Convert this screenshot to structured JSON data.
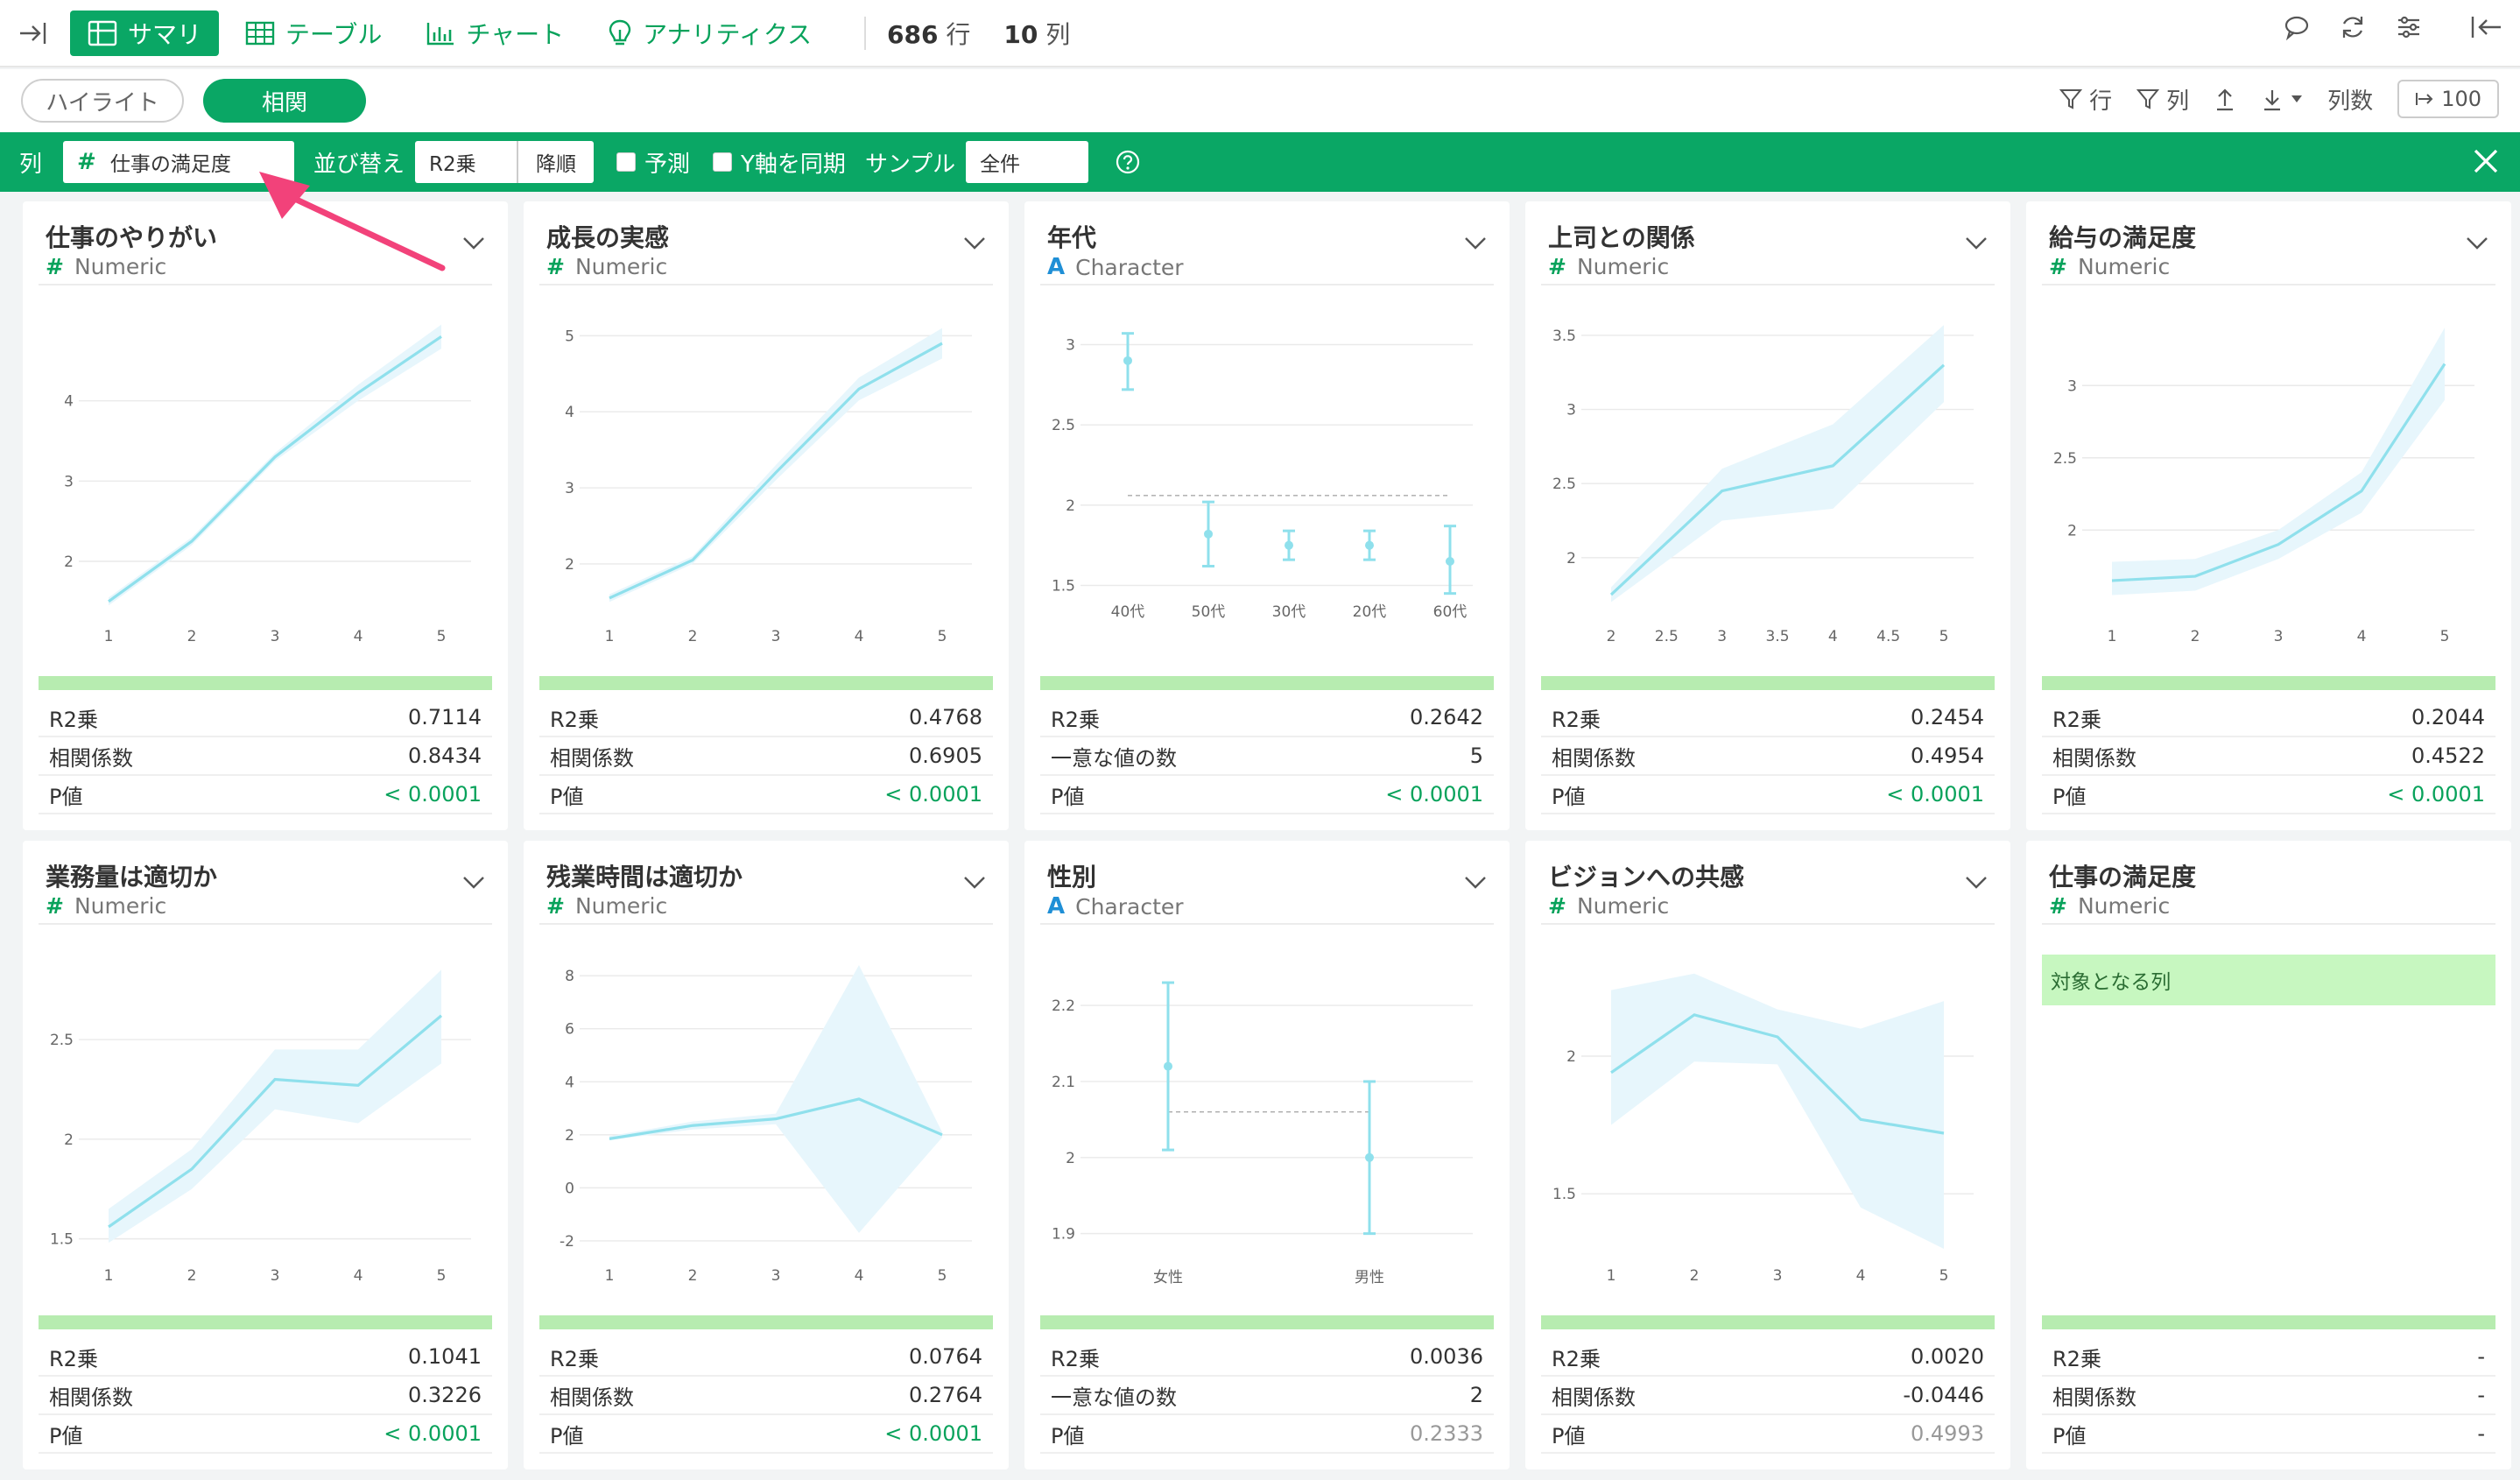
{
  "topbar": {
    "tabs": [
      {
        "label": "サマリ",
        "icon": "grid-icon",
        "active": true
      },
      {
        "label": "テーブル",
        "icon": "table-icon",
        "active": false
      },
      {
        "label": "チャート",
        "icon": "bar-chart-icon",
        "active": false
      },
      {
        "label": "アナリティクス",
        "icon": "lightbulb-icon",
        "active": false
      }
    ],
    "rows": "686",
    "rows_unit": "行",
    "cols": "10",
    "cols_unit": "列"
  },
  "secondbar": {
    "highlight_label": "ハイライト",
    "correlation_label": "相関",
    "filter_row_label": "行",
    "filter_col_label": "列",
    "columns_label": "列数",
    "columns_value": "100"
  },
  "greenbar": {
    "col_label": "列",
    "target_column": "仕事の満足度",
    "sort_label": "並び替え",
    "sort_field": "R2乗",
    "sort_order": "降順",
    "predict_label": "予測",
    "sync_y_label": "Y軸を同期",
    "sample_label": "サンプル",
    "sample_value": "全件"
  },
  "stat_labels": {
    "r2": "R2乗",
    "corr": "相関係数",
    "unique": "一意な値の数",
    "p": "P値"
  },
  "cards": [
    {
      "title": "仕事のやりがい",
      "type": "Numeric",
      "stat2_label": "相関係数",
      "r2": "0.7114",
      "stat2": "0.8434",
      "p": "< 0.0001",
      "p_sig": true
    },
    {
      "title": "成長の実感",
      "type": "Numeric",
      "stat2_label": "相関係数",
      "r2": "0.4768",
      "stat2": "0.6905",
      "p": "< 0.0001",
      "p_sig": true
    },
    {
      "title": "年代",
      "type": "Character",
      "stat2_label": "一意な値の数",
      "r2": "0.2642",
      "stat2": "5",
      "p": "< 0.0001",
      "p_sig": true
    },
    {
      "title": "上司との関係",
      "type": "Numeric",
      "stat2_label": "相関係数",
      "r2": "0.2454",
      "stat2": "0.4954",
      "p": "< 0.0001",
      "p_sig": true
    },
    {
      "title": "給与の満足度",
      "type": "Numeric",
      "stat2_label": "相関係数",
      "r2": "0.2044",
      "stat2": "0.4522",
      "p": "< 0.0001",
      "p_sig": true
    },
    {
      "title": "業務量は適切か",
      "type": "Numeric",
      "stat2_label": "相関係数",
      "r2": "0.1041",
      "stat2": "0.3226",
      "p": "< 0.0001",
      "p_sig": true
    },
    {
      "title": "残業時間は適切か",
      "type": "Numeric",
      "stat2_label": "相関係数",
      "r2": "0.0764",
      "stat2": "0.2764",
      "p": "< 0.0001",
      "p_sig": true
    },
    {
      "title": "性別",
      "type": "Character",
      "stat2_label": "一意な値の数",
      "r2": "0.0036",
      "stat2": "2",
      "p": "0.2333",
      "p_sig": false
    },
    {
      "title": "ビジョンへの共感",
      "type": "Numeric",
      "stat2_label": "相関係数",
      "r2": "0.0020",
      "stat2": "-0.0446",
      "p": "0.4993",
      "p_sig": false
    },
    {
      "title": "仕事の満足度",
      "type": "Numeric",
      "stat2_label": "相関係数",
      "r2": "-",
      "stat2": "-",
      "p": "-",
      "p_sig": false,
      "is_target": true,
      "target_text": "対象となる列"
    }
  ],
  "chart_data": [
    {
      "type": "line",
      "title": "仕事のやりがい",
      "x": [
        1,
        2,
        3,
        4,
        5
      ],
      "y": [
        1.5,
        2.25,
        3.3,
        4.1,
        4.8
      ],
      "ci_low": [
        1.45,
        2.2,
        3.25,
        4.0,
        4.65
      ],
      "ci_high": [
        1.55,
        2.3,
        3.35,
        4.2,
        4.95
      ],
      "xticks": [
        "1",
        "2",
        "3",
        "4",
        "5"
      ],
      "yticks": [
        2,
        3,
        4
      ],
      "ylim": [
        1.4,
        5.0
      ]
    },
    {
      "type": "line",
      "title": "成長の実感",
      "x": [
        1,
        2,
        3,
        4,
        5
      ],
      "y": [
        1.55,
        2.05,
        3.2,
        4.3,
        4.9
      ],
      "ci_low": [
        1.5,
        2.0,
        3.1,
        4.15,
        4.7
      ],
      "ci_high": [
        1.6,
        2.1,
        3.3,
        4.45,
        5.1
      ],
      "xticks": [
        "1",
        "2",
        "3",
        "4",
        "5"
      ],
      "yticks": [
        2,
        3,
        4,
        5
      ],
      "ylim": [
        1.4,
        5.2
      ]
    },
    {
      "type": "errorbar",
      "title": "年代",
      "categories": [
        "40代",
        "50代",
        "30代",
        "20代",
        "60代"
      ],
      "y": [
        2.9,
        1.82,
        1.75,
        1.75,
        1.65
      ],
      "err_low": [
        2.72,
        1.62,
        1.66,
        1.66,
        1.45
      ],
      "err_high": [
        3.07,
        2.02,
        1.84,
        1.84,
        1.87
      ],
      "mean_line": 2.06,
      "yticks": [
        1.5,
        2,
        2.5,
        3
      ],
      "ylim": [
        1.35,
        3.15
      ]
    },
    {
      "type": "line",
      "title": "上司との関係",
      "x": [
        2,
        3,
        4,
        5
      ],
      "y": [
        1.75,
        2.45,
        2.62,
        3.3
      ],
      "ci_low": [
        1.7,
        2.25,
        2.33,
        3.05
      ],
      "ci_high": [
        1.8,
        2.6,
        2.9,
        3.57
      ],
      "xticks": [
        "2",
        "2.5",
        "3",
        "3.5",
        "4",
        "4.5",
        "5"
      ],
      "xtick_vals": [
        2,
        2.5,
        3,
        3.5,
        4,
        4.5,
        5
      ],
      "yticks": [
        2,
        2.5,
        3,
        3.5
      ],
      "ylim": [
        1.65,
        3.6
      ]
    },
    {
      "type": "line",
      "title": "給与の満足度",
      "x": [
        1,
        2,
        3,
        4,
        5
      ],
      "y": [
        1.65,
        1.68,
        1.9,
        2.27,
        3.15
      ],
      "ci_low": [
        1.55,
        1.58,
        1.8,
        2.12,
        2.9
      ],
      "ci_high": [
        1.78,
        1.8,
        2.0,
        2.4,
        3.4
      ],
      "xticks": [
        "1",
        "2",
        "3",
        "4",
        "5"
      ],
      "yticks": [
        2,
        2.5,
        3
      ],
      "ylim": [
        1.45,
        3.45
      ]
    },
    {
      "type": "line",
      "title": "業務量は適切か",
      "x": [
        1,
        2,
        3,
        4,
        5
      ],
      "y": [
        1.56,
        1.85,
        2.3,
        2.27,
        2.62
      ],
      "ci_low": [
        1.48,
        1.75,
        2.15,
        2.08,
        2.38
      ],
      "ci_high": [
        1.65,
        1.95,
        2.45,
        2.45,
        2.85
      ],
      "xticks": [
        "1",
        "2",
        "3",
        "4",
        "5"
      ],
      "yticks": [
        1.5,
        2,
        2.5
      ],
      "ylim": [
        1.45,
        2.9
      ]
    },
    {
      "type": "line",
      "title": "残業時間は適切か",
      "x": [
        1,
        2,
        3,
        4,
        5
      ],
      "y": [
        1.85,
        2.35,
        2.6,
        3.35,
        2.0
      ],
      "ci_low": [
        1.8,
        2.2,
        2.4,
        -1.7,
        1.9
      ],
      "ci_high": [
        1.95,
        2.5,
        2.8,
        8.4,
        2.1
      ],
      "xticks": [
        "1",
        "2",
        "3",
        "4",
        "5"
      ],
      "yticks": [
        -2,
        0,
        2,
        4,
        6,
        8
      ],
      "ylim": [
        -2.3,
        8.6
      ]
    },
    {
      "type": "errorbar",
      "title": "性別",
      "categories": [
        "女性",
        "男性"
      ],
      "y": [
        2.12,
        2.0
      ],
      "err_low": [
        2.01,
        1.9
      ],
      "err_high": [
        2.23,
        2.1
      ],
      "mean_line": 2.06,
      "yticks": [
        1.9,
        2,
        2.1,
        2.2
      ],
      "ylim": [
        1.88,
        2.26
      ]
    },
    {
      "type": "line",
      "title": "ビジョンへの共感",
      "x": [
        1,
        2,
        3,
        4,
        5
      ],
      "y": [
        1.94,
        2.15,
        2.07,
        1.77,
        1.72
      ],
      "ci_low": [
        1.75,
        1.98,
        1.97,
        1.45,
        1.3
      ],
      "ci_high": [
        2.24,
        2.3,
        2.17,
        2.1,
        2.2
      ],
      "xticks": [
        "1",
        "2",
        "3",
        "4",
        "5"
      ],
      "yticks": [
        1.5,
        2
      ],
      "ylim": [
        1.3,
        2.35
      ]
    }
  ],
  "colors": {
    "green": "#0aa765",
    "line": "#8fe0ec",
    "band": "#e7f6fc",
    "accent_arrow": "#f2427a"
  }
}
